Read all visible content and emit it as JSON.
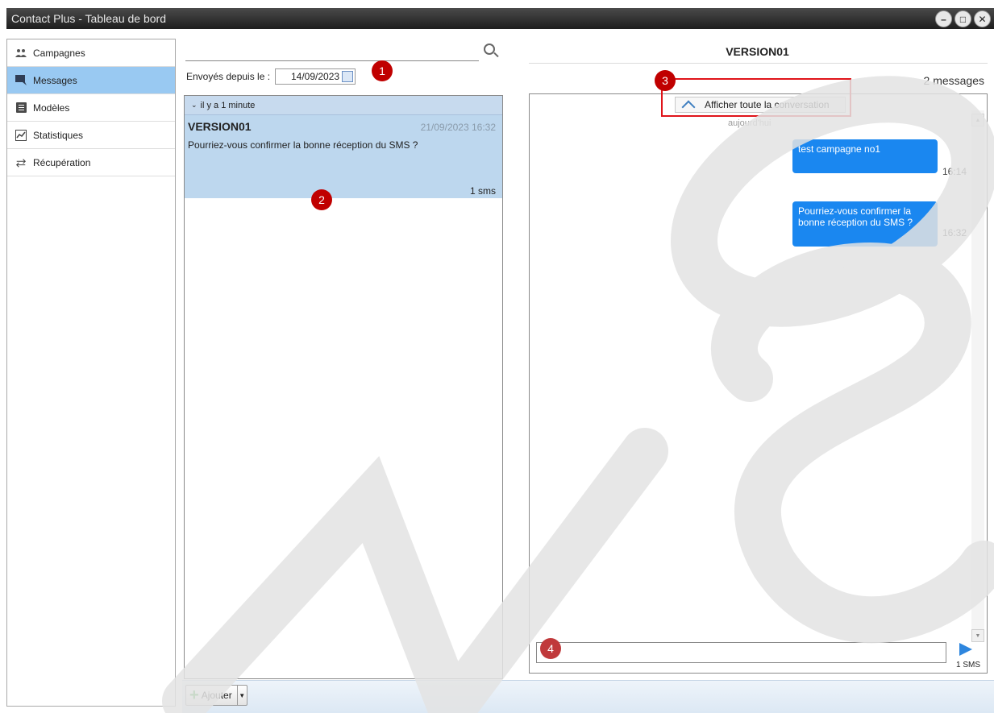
{
  "window": {
    "title": "Contact Plus - Tableau de bord",
    "buttons": {
      "minimize": "–",
      "maximize": "□",
      "close": "✕"
    }
  },
  "sidebar": {
    "items": [
      {
        "label": "Campagnes",
        "icon": "people-icon"
      },
      {
        "label": "Messages",
        "icon": "chat-icon"
      },
      {
        "label": "Modèles",
        "icon": "document-icon"
      },
      {
        "label": "Statistiques",
        "icon": "chart-icon"
      },
      {
        "label": "Récupération",
        "icon": "sync-arrows-icon"
      }
    ],
    "active": "Messages"
  },
  "message_list": {
    "filter_label": "Envoyés depuis le :",
    "filter_date": "14/09/2023",
    "group_header": "il y a 1 minute",
    "items": [
      {
        "name": "VERSION01",
        "date": "21/09/2023 16:32",
        "text": "Pourriez-vous confirmer la bonne réception du SMS ?",
        "count": "1 sms"
      }
    ]
  },
  "bottom_bar": {
    "add_label": "Ajouter"
  },
  "conversation": {
    "title": "VERSION01",
    "count": "2 messages",
    "show_all_bold": "Afficher",
    "show_all_rest": " toute la conversation",
    "day_label": "aujourd'hui",
    "messages": [
      {
        "text": "test campagne no1",
        "time": "16:14"
      },
      {
        "text": "Pourriez-vous confirmer la bonne réception du SMS ?",
        "time": "16:32"
      }
    ],
    "sms_counter": "1 SMS"
  },
  "annotations": [
    "1",
    "2",
    "3",
    "4"
  ],
  "watermark": "NSO",
  "colors": {
    "accent_blue": "#1a87f0",
    "selected_bg": "#bdd7ee",
    "badge_red": "#c00000"
  }
}
